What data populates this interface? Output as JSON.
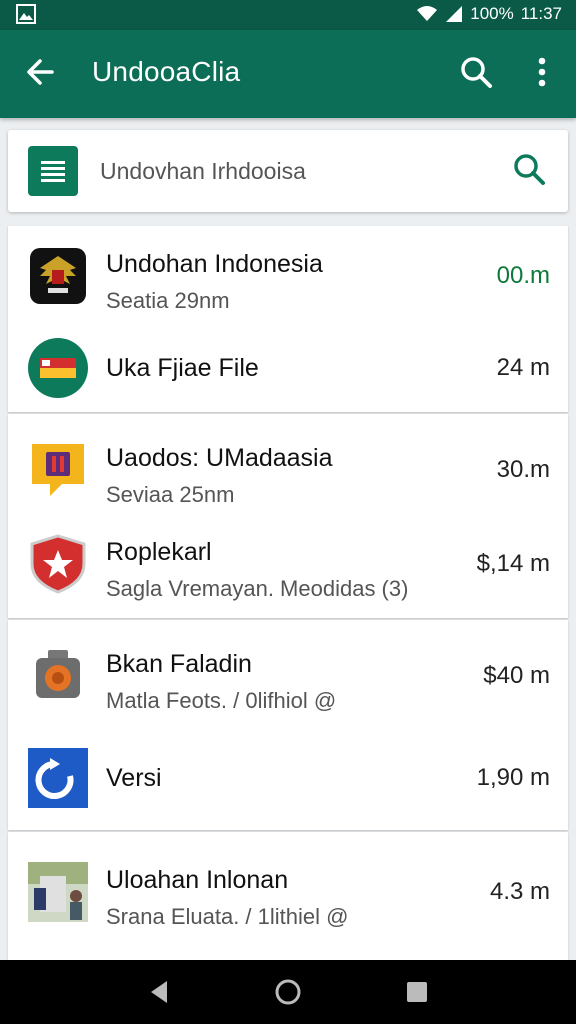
{
  "status_bar": {
    "time": "11:37",
    "battery_text": "100%"
  },
  "app_bar": {
    "title": "UndooaClia"
  },
  "search": {
    "text": "Undovhan Irhdooisa"
  },
  "groups": [
    [
      {
        "name": "Undohan Indonesia",
        "sub": "Seatia 29nm",
        "value": "00.m",
        "icon": "garuda-emblem-icon"
      },
      {
        "name": "Uka Fjiae File",
        "sub": "",
        "value": "24 m",
        "icon": "flag-icon"
      }
    ],
    [
      {
        "name": "Uaodos: UMadaasia",
        "sub": "Seviaa 25nm",
        "value": "30.m",
        "icon": "badge-icon"
      },
      {
        "name": "Roplekarl",
        "sub": "Sagla Vremayan. Meodidas (3)",
        "value": "$,14 m",
        "icon": "star-shield-icon"
      }
    ],
    [
      {
        "name": "Bkan Faladin",
        "sub": "Matla Feots. / 0lifhiol @",
        "value": "$40 m",
        "icon": "camera-icon"
      },
      {
        "name": "Versi",
        "sub": "",
        "value": "1,90 m",
        "icon": "refresh-icon"
      }
    ],
    [
      {
        "name": "Uloahan Inlonan",
        "sub": "Srana Eluata. / 1lithiel @",
        "value": "4.3 m",
        "icon": "photo-thumbnail-icon"
      }
    ]
  ],
  "colors": {
    "app_bar": "#0d6e57",
    "status_bar": "#0a5a47",
    "accent": "#0d7a5c"
  }
}
